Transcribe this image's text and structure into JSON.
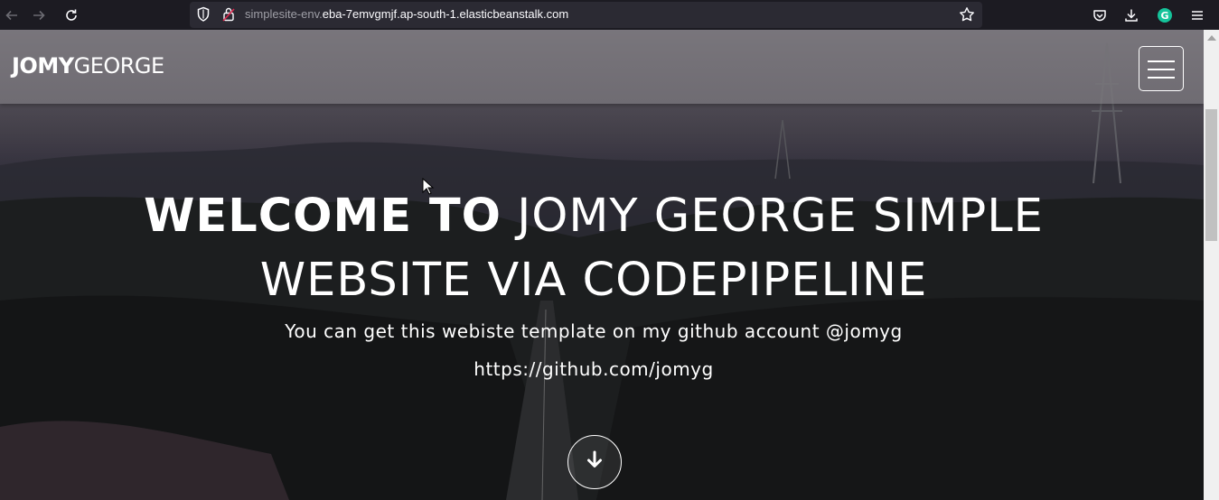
{
  "browser": {
    "url_dim": "simplesite-env.",
    "url_main": "eba-7emvgmjf.ap-south-1.elasticbeanstalk.com",
    "icons": [
      "back-icon",
      "forward-icon",
      "reload-icon",
      "shield-icon",
      "lock-icon",
      "star-icon",
      "pocket-icon",
      "download-icon",
      "grammarly-icon",
      "menu-icon"
    ]
  },
  "navbar": {
    "brand_bold": "JOMY",
    "brand_light": "GEORGE"
  },
  "hero": {
    "title_bold": "WELCOME TO",
    "title_rest_line1": "JOMY GEORGE SIMPLE",
    "title_line2": "WEBSITE VIA CODEPIPELINE",
    "subtitle": "You can get this webiste template on my github account @jomyg",
    "link": "https://github.com/jomyg"
  },
  "colors": {
    "toolbar_bg": "#1c1b22",
    "urlbar_bg": "#2b2a33",
    "navbar_bg": "#7d7a80",
    "text": "#ffffff",
    "grammarly": "#15c39a"
  }
}
